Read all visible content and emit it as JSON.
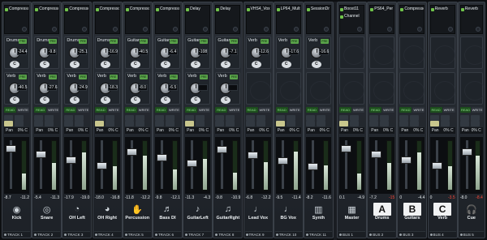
{
  "tracks": [
    {
      "name": "Kick",
      "footer": "TRACK 1",
      "insert": "Compressor",
      "send1": {
        "name": "Drums",
        "value": "-24.4"
      },
      "send2": {
        "name": "Verb",
        "value": "-40.5"
      },
      "vals": [
        "-8.7",
        "-11.2"
      ],
      "icon": "kick-drum-icon",
      "glyph": "◉"
    },
    {
      "name": "Snare",
      "footer": "TRACK 2",
      "insert": "Compressor",
      "send1": {
        "name": "Drums",
        "value": "-9.8"
      },
      "send2": {
        "name": "Verb",
        "value": "-27.6"
      },
      "vals": [
        "-5.4",
        "-11.3"
      ],
      "icon": "snare-drum-icon",
      "glyph": "◎"
    },
    {
      "name": "OH Left",
      "footer": "TRACK 3",
      "insert": "Compressor",
      "send1": {
        "name": "Drums",
        "value": "-25.1"
      },
      "send2": {
        "name": "Verb",
        "value": "-24.9"
      },
      "vals": [
        "-17.9",
        "-19.0"
      ],
      "icon": "cymbal-icon",
      "glyph": "◔"
    },
    {
      "name": "OH Right",
      "footer": "TRACK 4",
      "insert": "Compressor",
      "send1": {
        "name": "Drums",
        "value": "-16.9"
      },
      "send2": {
        "name": "Verb",
        "value": "-18.3"
      },
      "vals": [
        "-18.0",
        "-16.8"
      ],
      "icon": "cymbal-icon",
      "glyph": "◕"
    },
    {
      "name": "Percussion",
      "footer": "TRACK 5",
      "insert": "Compressor",
      "send1": {
        "name": "Guitars",
        "value": "-40.5"
      },
      "send2": {
        "name": "Verb",
        "value": "-8.0"
      },
      "vals": [
        "-11.8",
        "-12.2"
      ],
      "icon": "hands-percussion-icon",
      "glyph": "✋"
    },
    {
      "name": "Bass DI",
      "footer": "TRACK 6",
      "insert": "Compressor",
      "send1": {
        "name": "Guitars",
        "value": "-6.4"
      },
      "send2": {
        "name": "Verb",
        "value": "-6.5"
      },
      "vals": [
        "-9.8",
        "-12.1"
      ],
      "icon": "bass-guitar-icon",
      "glyph": "♬"
    },
    {
      "name": "GuitarLeft",
      "footer": "TRACK 7",
      "insert": "Delay",
      "send1": {
        "name": "Guitars",
        "value": "-108"
      },
      "send2": {
        "name": "Verb",
        "value": ""
      },
      "vals": [
        "-11.3",
        "-4.3"
      ],
      "icon": "electric-guitar-icon",
      "glyph": "♪"
    },
    {
      "name": "GuitarRght",
      "footer": "TRACK 8",
      "insert": "Delay",
      "send1": {
        "name": "Guitars",
        "value": "-7.1"
      },
      "send2": {
        "name": "Verb",
        "value": ""
      },
      "vals": [
        "-9.8",
        "-10.9"
      ],
      "icon": "electric-guitar-icon",
      "glyph": "♫"
    },
    {
      "name": "Lead Vox",
      "footer": "TRACK 9",
      "insert": "VHS4_Vox",
      "send1": {
        "name": "Verb",
        "value": "-12.6"
      },
      "send2": null,
      "vals": [
        "-6.8",
        "-12.2"
      ],
      "icon": "microphone-icon",
      "glyph": "♩"
    },
    {
      "name": "BG Vox",
      "footer": "TRACK 10",
      "insert": "LP64_Multi",
      "send1": {
        "name": "Verb",
        "value": "-17.6"
      },
      "send2": null,
      "vals": [
        "-9.5",
        "-11.4"
      ],
      "icon": "microphone-icon",
      "glyph": "♩"
    },
    {
      "name": "Synth",
      "footer": "TRACK 11",
      "insert": "SessionDr",
      "send1": {
        "name": "Verb",
        "value": "-16.6"
      },
      "send2": null,
      "vals": [
        "-8.2",
        "-11.6"
      ],
      "icon": "keyboard-icon",
      "glyph": "▥"
    }
  ],
  "buses": [
    {
      "name": "Master",
      "footer": "BUS 1",
      "inserts": [
        "Boost11",
        "Channel"
      ],
      "vals": [
        "0.1",
        "-4.9"
      ],
      "redIndex": -1,
      "icon": "master-bus-icon",
      "glyph": "▦"
    },
    {
      "name": "Drums",
      "footer": "BUS 2",
      "inserts": [
        "PS64_Per"
      ],
      "vals": [
        "-7.2",
        "-15"
      ],
      "redIndex": 1,
      "icon": "letter-a-icon",
      "glyph": "A"
    },
    {
      "name": "Guitars",
      "footer": "BUS 3",
      "inserts": [
        "Compressor"
      ],
      "vals": [
        "0",
        "-4.4"
      ],
      "redIndex": -1,
      "icon": "letter-b-icon",
      "glyph": "B"
    },
    {
      "name": "Verb",
      "footer": "BUS 4",
      "inserts": [
        "Reverb"
      ],
      "vals": [
        "0",
        "-3.5"
      ],
      "redIndex": 1,
      "icon": "letter-c-icon",
      "glyph": "C"
    },
    {
      "name": "Cue",
      "footer": "BUS 5",
      "inserts": [
        "Reverb"
      ],
      "vals": [
        "-8.0",
        "-8.4"
      ],
      "redIndex": 1,
      "icon": "headphones-icon",
      "glyph": "🎧"
    }
  ],
  "labels": {
    "read": "READ",
    "write": "WRITE",
    "pan": "Pan",
    "pan_value": "0% C",
    "send_pre": "PRE",
    "send_pan": "C"
  }
}
